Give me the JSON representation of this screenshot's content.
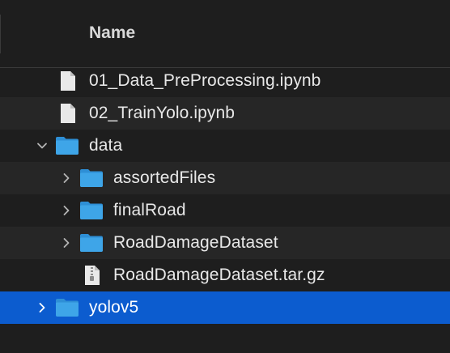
{
  "header": {
    "name_column": "Name"
  },
  "rows": [
    {
      "name": "01_Data_PreProcessing.ipynb",
      "kind": "file-icon",
      "depth": 0,
      "expandable": false,
      "expanded": false,
      "selected": false
    },
    {
      "name": "02_TrainYolo.ipynb",
      "kind": "file-icon",
      "depth": 0,
      "expandable": false,
      "expanded": false,
      "selected": false
    },
    {
      "name": "data",
      "kind": "folder-icon",
      "depth": 0,
      "expandable": true,
      "expanded": true,
      "selected": false
    },
    {
      "name": "assortedFiles",
      "kind": "folder-icon",
      "depth": 1,
      "expandable": true,
      "expanded": false,
      "selected": false
    },
    {
      "name": "finalRoad",
      "kind": "folder-icon",
      "depth": 1,
      "expandable": true,
      "expanded": false,
      "selected": false
    },
    {
      "name": "RoadDamageDataset",
      "kind": "folder-icon",
      "depth": 1,
      "expandable": true,
      "expanded": false,
      "selected": false
    },
    {
      "name": "RoadDamageDataset.tar.gz",
      "kind": "archive-icon",
      "depth": 1,
      "expandable": false,
      "expanded": false,
      "selected": false
    },
    {
      "name": "yolov5",
      "kind": "folder-icon",
      "depth": 0,
      "expandable": true,
      "expanded": false,
      "selected": true
    }
  ],
  "colors": {
    "background": "#1e1e1e",
    "alt_row": "#262626",
    "selection": "#0c5ccf",
    "folder": "#3ea5e8"
  }
}
